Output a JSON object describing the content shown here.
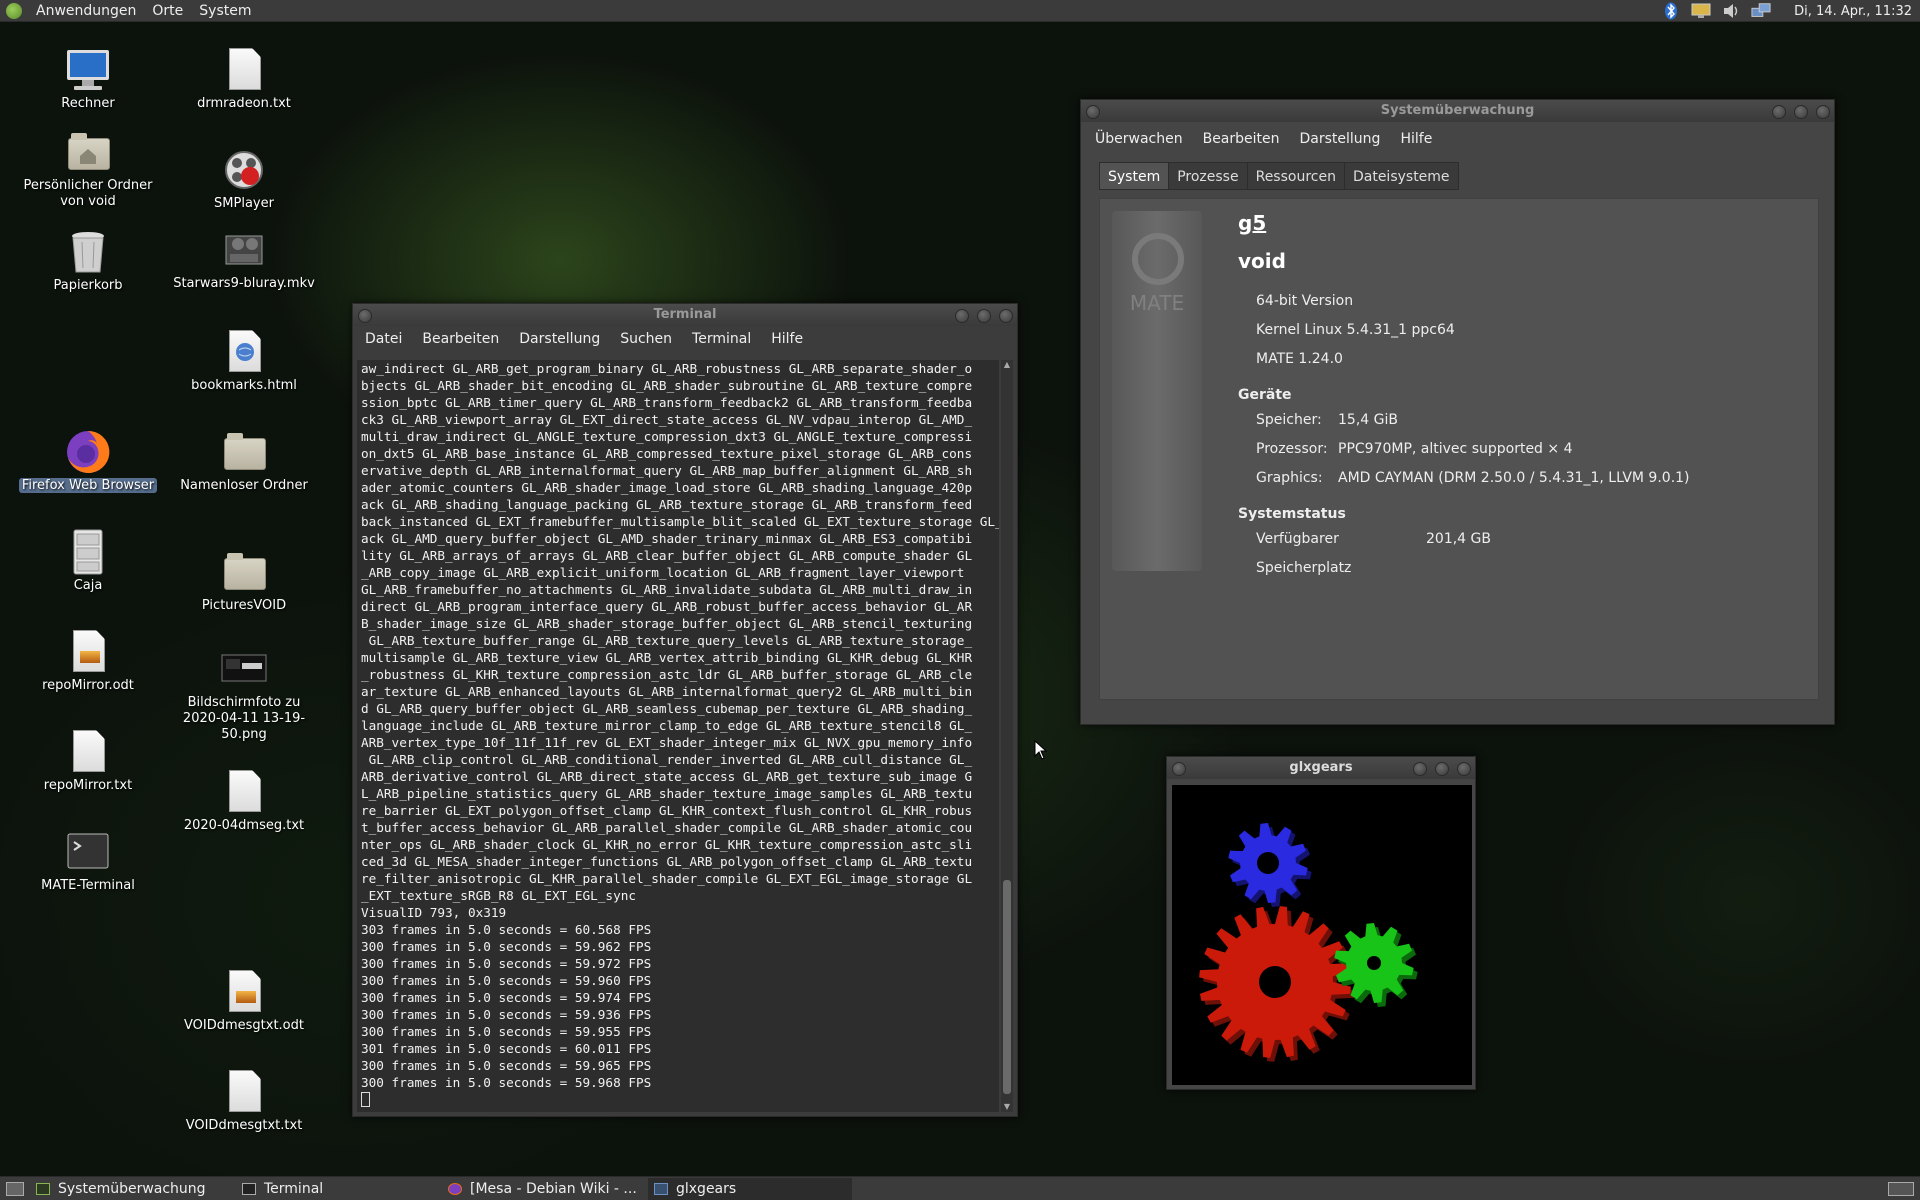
{
  "top_panel": {
    "menus": [
      "Anwendungen",
      "Orte",
      "System"
    ],
    "clock": "Di, 14. Apr., 11:32",
    "tray_icons": [
      "bluetooth-icon",
      "display-icon",
      "volume-icon",
      "network-icon"
    ]
  },
  "desktop_icons": [
    {
      "label": "Rechner",
      "icon": "computer-icon"
    },
    {
      "label": "Persönlicher Ordner von void",
      "icon": "home-folder-icon"
    },
    {
      "label": "Papierkorb",
      "icon": "trash-icon"
    },
    {
      "label": "Firefox Web Browser",
      "icon": "firefox-icon"
    },
    {
      "label": "Caja",
      "icon": "file-cabinet-icon"
    },
    {
      "label": "repoMirror.odt",
      "icon": "document-icon"
    },
    {
      "label": "repoMirror.txt",
      "icon": "text-file-icon"
    },
    {
      "label": "MATE-Terminal",
      "icon": "terminal-icon"
    },
    {
      "label": "drmradeon.txt",
      "icon": "text-file-icon"
    },
    {
      "label": "SMPlayer",
      "icon": "smplayer-icon"
    },
    {
      "label": "Starwars9-bluray.mkv",
      "icon": "video-file-icon"
    },
    {
      "label": "bookmarks.html",
      "icon": "html-file-icon"
    },
    {
      "label": "Namenloser Ordner",
      "icon": "folder-icon"
    },
    {
      "label": "PicturesVOID",
      "icon": "folder-icon"
    },
    {
      "label": "Bildschirmfoto zu 2020-04-11 13-19-50.png",
      "icon": "image-file-icon"
    },
    {
      "label": "2020-04dmseg.txt",
      "icon": "text-file-icon"
    },
    {
      "label": "VOIDdmesgtxt.odt",
      "icon": "document-icon"
    },
    {
      "label": "VOIDdmesgtxt.txt",
      "icon": "text-file-icon"
    }
  ],
  "terminal": {
    "title": "Terminal",
    "menus": [
      "Datei",
      "Bearbeiten",
      "Darstellung",
      "Suchen",
      "Terminal",
      "Hilfe"
    ],
    "lines": [
      "aw_indirect GL_ARB_get_program_binary GL_ARB_robustness GL_ARB_separate_shader_o",
      "bjects GL_ARB_shader_bit_encoding GL_ARB_shader_subroutine GL_ARB_texture_compre",
      "ssion_bptc GL_ARB_timer_query GL_ARB_transform_feedback2 GL_ARB_transform_feedba",
      "ck3 GL_ARB_viewport_array GL_EXT_direct_state_access GL_NV_vdpau_interop GL_AMD_",
      "multi_draw_indirect GL_ANGLE_texture_compression_dxt3 GL_ANGLE_texture_compressi",
      "on_dxt5 GL_ARB_base_instance GL_ARB_compressed_texture_pixel_storage GL_ARB_cons",
      "ervative_depth GL_ARB_internalformat_query GL_ARB_map_buffer_alignment GL_ARB_sh",
      "ader_atomic_counters GL_ARB_shader_image_load_store GL_ARB_shading_language_420p",
      "ack GL_ARB_shading_language_packing GL_ARB_texture_storage GL_ARB_transform_feed",
      "back_instanced GL_EXT_framebuffer_multisample_blit_scaled GL_EXT_texture_storage GL_ARB",
      "ack GL_AMD_query_buffer_object GL_AMD_shader_trinary_minmax GL_ARB_ES3_compatibi",
      "lity GL_ARB_arrays_of_arrays GL_ARB_clear_buffer_object GL_ARB_compute_shader GL",
      "_ARB_copy_image GL_ARB_explicit_uniform_location GL_ARB_fragment_layer_viewport",
      "GL_ARB_framebuffer_no_attachments GL_ARB_invalidate_subdata GL_ARB_multi_draw_in",
      "direct GL_ARB_program_interface_query GL_ARB_robust_buffer_access_behavior GL_AR",
      "B_shader_image_size GL_ARB_shader_storage_buffer_object GL_ARB_stencil_texturing",
      " GL_ARB_texture_buffer_range GL_ARB_texture_query_levels GL_ARB_texture_storage_",
      "multisample GL_ARB_texture_view GL_ARB_vertex_attrib_binding GL_KHR_debug GL_KHR",
      "_robustness GL_KHR_texture_compression_astc_ldr GL_ARB_buffer_storage GL_ARB_cle",
      "ar_texture GL_ARB_enhanced_layouts GL_ARB_internalformat_query2 GL_ARB_multi_bin",
      "d GL_ARB_query_buffer_object GL_ARB_seamless_cubemap_per_texture GL_ARB_shading_",
      "language_include GL_ARB_texture_mirror_clamp_to_edge GL_ARB_texture_stencil8 GL_",
      "ARB_vertex_type_10f_11f_11f_rev GL_EXT_shader_integer_mix GL_NVX_gpu_memory_info",
      " GL_ARB_clip_control GL_ARB_conditional_render_inverted GL_ARB_cull_distance GL_",
      "ARB_derivative_control GL_ARB_direct_state_access GL_ARB_get_texture_sub_image G",
      "L_ARB_pipeline_statistics_query GL_ARB_shader_texture_image_samples GL_ARB_textu",
      "re_barrier GL_EXT_polygon_offset_clamp GL_KHR_context_flush_control GL_KHR_robus",
      "t_buffer_access_behavior GL_ARB_parallel_shader_compile GL_ARB_shader_atomic_cou",
      "nter_ops GL_ARB_shader_clock GL_KHR_no_error GL_KHR_texture_compression_astc_sli",
      "ced_3d GL_MESA_shader_integer_functions GL_ARB_polygon_offset_clamp GL_ARB_textu",
      "re_filter_anisotropic GL_KHR_parallel_shader_compile GL_EXT_EGL_image_storage GL",
      "_EXT_texture_sRGB_R8 GL_EXT_EGL_sync",
      "VisualID 793, 0x319",
      "303 frames in 5.0 seconds = 60.568 FPS",
      "300 frames in 5.0 seconds = 59.962 FPS",
      "300 frames in 5.0 seconds = 59.972 FPS",
      "300 frames in 5.0 seconds = 59.960 FPS",
      "300 frames in 5.0 seconds = 59.974 FPS",
      "300 frames in 5.0 seconds = 59.936 FPS",
      "300 frames in 5.0 seconds = 59.955 FPS",
      "301 frames in 5.0 seconds = 60.011 FPS",
      "300 frames in 5.0 seconds = 59.965 FPS",
      "300 frames in 5.0 seconds = 59.968 FPS"
    ]
  },
  "sysmon": {
    "title": "Systemüberwachung",
    "menus": [
      "Überwachen",
      "Bearbeiten",
      "Darstellung",
      "Hilfe"
    ],
    "tabs": [
      "System",
      "Prozesse",
      "Ressourcen",
      "Dateisysteme"
    ],
    "active_tab": "System",
    "logo_text": "MATE",
    "hostname": "g5",
    "distro": "void",
    "version": "64-bit Version",
    "kernel": "Kernel Linux 5.4.31_1 ppc64",
    "desktop": "MATE 1.24.0",
    "devices_heading": "Geräte",
    "memory_label": "Speicher:",
    "memory_value": "15,4 GiB",
    "cpu_label": "Prozessor:",
    "cpu_value": "PPC970MP, altivec supported × 4",
    "gpu_label": "Graphics:",
    "gpu_value": "AMD CAYMAN (DRM 2.50.0 / 5.4.31_1, LLVM 9.0.1)",
    "status_heading": "Systemstatus",
    "disk_label": "Verfügbarer Speicherplatz",
    "disk_value": "201,4 GB"
  },
  "glxgears": {
    "title": "glxgears",
    "colors": {
      "red": "#cc1a0a",
      "green": "#17c417",
      "blue": "#2a2ae0"
    }
  },
  "taskbar": {
    "tasks": [
      {
        "label": "Systemüberwachung",
        "icon": "system-monitor-icon"
      },
      {
        "label": "Terminal",
        "icon": "terminal-icon"
      },
      {
        "label": "[Mesa - Debian Wiki - ...",
        "icon": "firefox-icon"
      },
      {
        "label": "glxgears",
        "icon": "window-icon"
      }
    ]
  }
}
